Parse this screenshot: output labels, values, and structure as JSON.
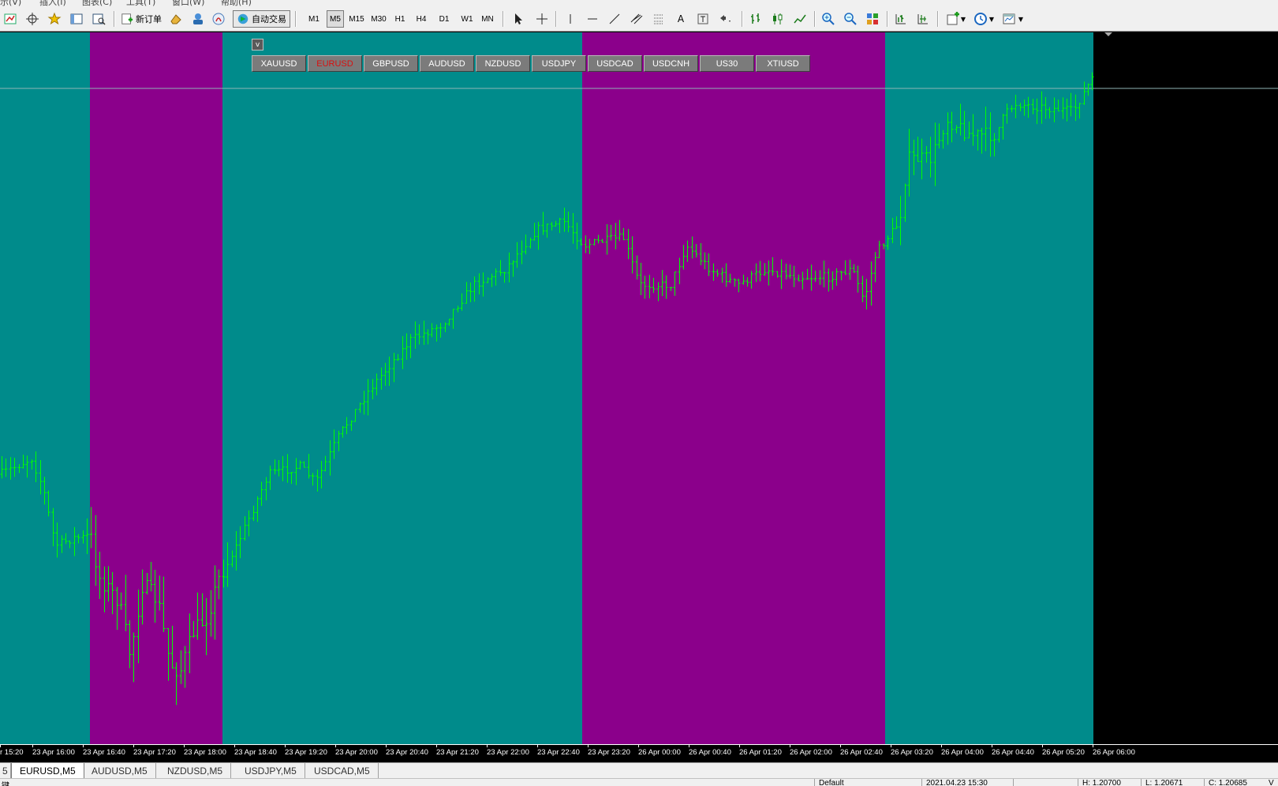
{
  "menu": [
    "示(V)",
    "插入(I)",
    "图表(C)",
    "工具(T)",
    "窗口(W)",
    "帮助(H)"
  ],
  "toolbar": {
    "new_order": "新订单",
    "auto_trade": "自动交易",
    "timeframes": [
      "M1",
      "M5",
      "M15",
      "M30",
      "H1",
      "H4",
      "D1",
      "W1",
      "MN"
    ],
    "active_timeframe": "M5",
    "text_tool": "A"
  },
  "symbols": {
    "toggle": "v",
    "buttons": [
      "XAUUSD",
      "EURUSD",
      "GBPUSD",
      "AUDUSD",
      "NZDUSD",
      "USDJPY",
      "USDCAD",
      "USDCNH",
      "US30",
      "XTIUSD"
    ],
    "active": "EURUSD"
  },
  "chart": {
    "symbol": "EURUSD",
    "timeframe": "M5",
    "colors": {
      "session_a": "#008b8b",
      "session_b": "#8b008b",
      "background": "#000000",
      "bars": "#00ff00",
      "grid": "#8fb5b5"
    },
    "time_labels": [
      "r 15:20",
      "23 Apr 16:00",
      "23 Apr 16:40",
      "23 Apr 17:20",
      "23 Apr 18:00",
      "23 Apr 18:40",
      "23 Apr 19:20",
      "23 Apr 20:00",
      "23 Apr 20:40",
      "23 Apr 21:20",
      "23 Apr 22:00",
      "23 Apr 22:40",
      "23 Apr 23:20",
      "26 Apr 00:00",
      "26 Apr 00:40",
      "26 Apr 01:20",
      "26 Apr 02:00",
      "26 Apr 02:40",
      "26 Apr 03:20",
      "26 Apr 04:00",
      "26 Apr 04:40",
      "26 Apr 05:20",
      "26 Apr 06:00"
    ]
  },
  "tabs": {
    "items": [
      "5",
      "EURUSD,M5",
      "AUDUSD,M5",
      "NZDUSD,M5",
      "USDJPY,M5",
      "USDCAD,M5"
    ],
    "active": "EURUSD,M5"
  },
  "status": {
    "left": "键",
    "profile": "Default",
    "datetime": "2021.04.23 15:30",
    "high": "H: 1.20700",
    "low": "L: 1.20671",
    "close": "C: 1.20685",
    "volume": "V"
  }
}
